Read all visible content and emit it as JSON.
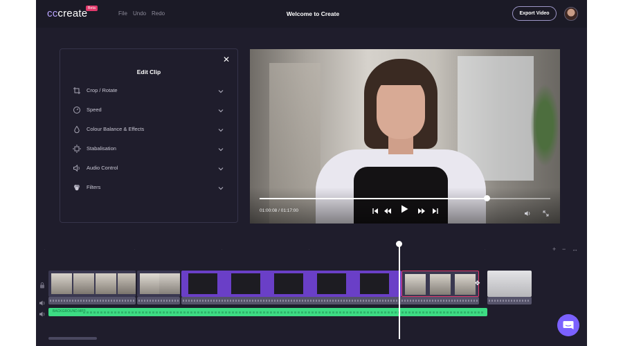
{
  "app": {
    "logo_prefix": "cc",
    "logo_suffix": "create",
    "beta_badge": "Beta"
  },
  "topbar": {
    "menu": [
      "File",
      "Undo",
      "Redo"
    ],
    "title": "Welcome to Create",
    "export_label": "Export Video"
  },
  "edit_panel": {
    "title": "Edit Clip",
    "options": [
      {
        "label": "Crop / Rotate",
        "icon": "crop-icon"
      },
      {
        "label": "Speed",
        "icon": "speed-icon"
      },
      {
        "label": "Colour Balance & Effects",
        "icon": "color-drop-icon"
      },
      {
        "label": "Stabalisation",
        "icon": "stabilise-icon"
      },
      {
        "label": "Audio Control",
        "icon": "speaker-icon"
      },
      {
        "label": "Filters",
        "icon": "filters-icon"
      }
    ]
  },
  "player": {
    "timecode": "01:00:08 / 01:17:00",
    "progress_fraction": 0.78
  },
  "timeline": {
    "audio_track_name": "BACKGROUND.MP3",
    "accent": "#7b61ff",
    "music_color": "#3ddc84",
    "selected_color": "#e2396c"
  }
}
